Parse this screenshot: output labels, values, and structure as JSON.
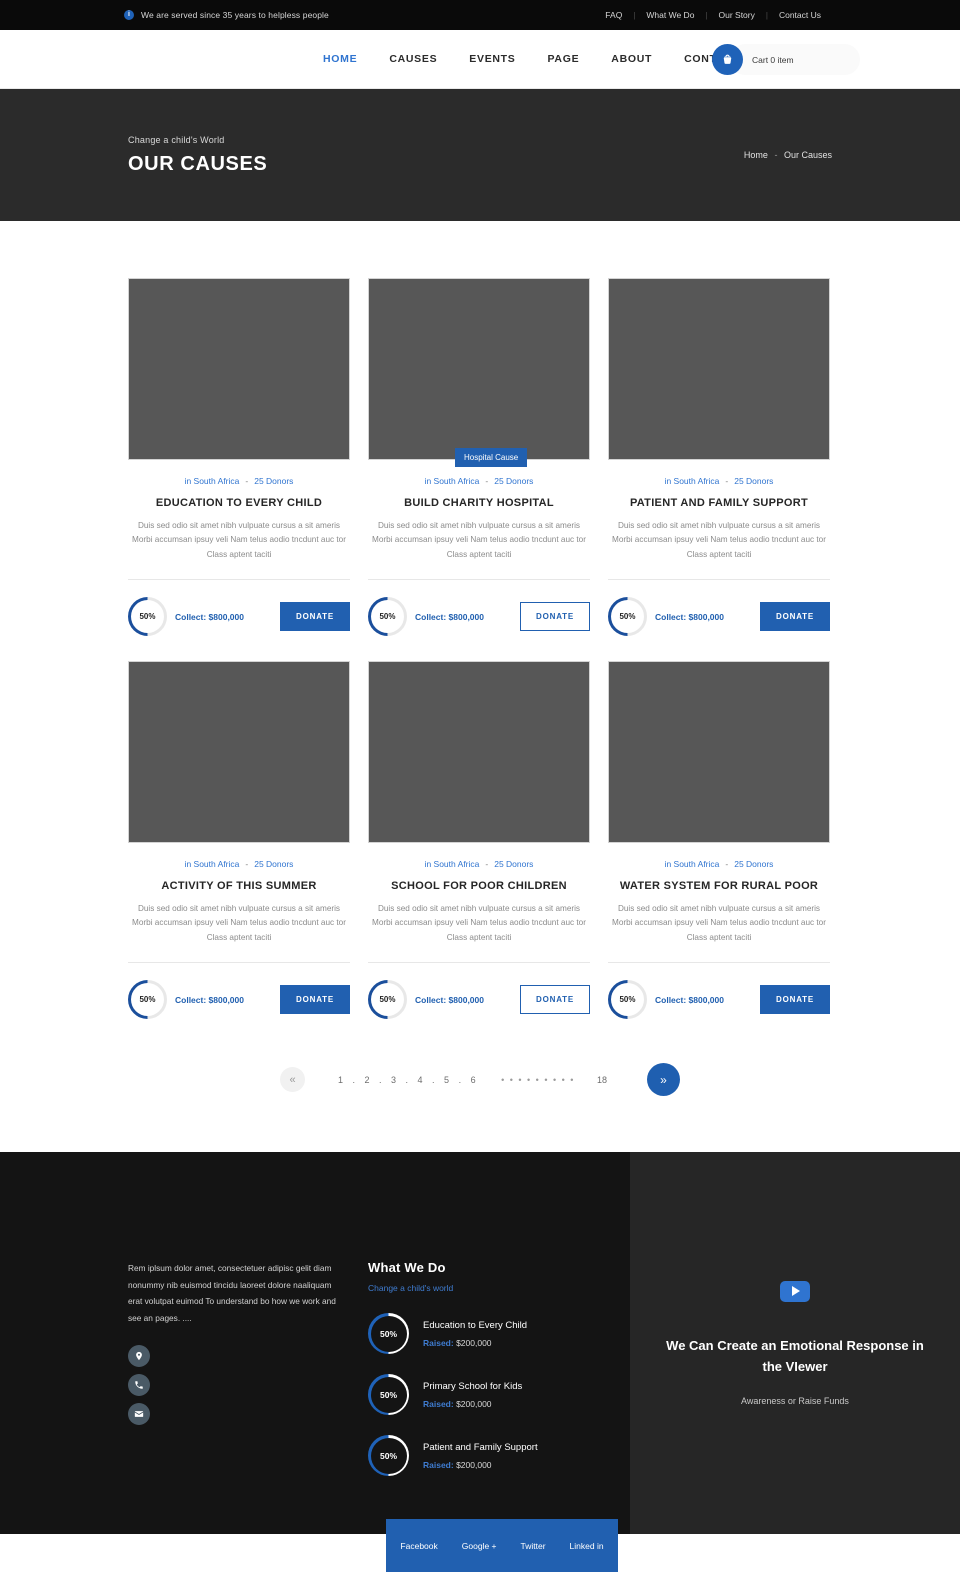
{
  "topbar": {
    "info_icon": "info-icon",
    "message": "We are served since 35 years to helpless people",
    "links": [
      {
        "label": "FAQ"
      },
      {
        "label": "What We Do"
      },
      {
        "label": "Our Story"
      },
      {
        "label": "Contact Us"
      }
    ],
    "separator": "|"
  },
  "nav": {
    "items": [
      {
        "label": "HOME",
        "active": true
      },
      {
        "label": "CAUSES",
        "active": false
      },
      {
        "label": "EVENTS",
        "active": false
      },
      {
        "label": "PAGE",
        "active": false
      },
      {
        "label": "ABOUT",
        "active": false
      },
      {
        "label": "CONTACT",
        "active": false
      }
    ],
    "cart_icon": "shopping-basket-icon",
    "cart_label": "Cart 0 item"
  },
  "hero": {
    "subtitle": "Change a child's World",
    "title": "OUR CAUSES",
    "breadcrumb_home": "Home",
    "breadcrumb_sep": "-",
    "breadcrumb_current": "Our Causes"
  },
  "causes": {
    "location_label": "in South Africa",
    "meta_sep": "-",
    "donors_label": "25 Donors",
    "description": "Duis sed odio sit amet nibh vulpuate cursus a sit ameris Morbi accumsan ipsuy veli Nam telus aodio tncdunt auc tor Class aptent taciti",
    "percent": "50%",
    "collect_label": "Collect:",
    "collect_amount": "$800,000",
    "donate_label": "DONATE",
    "cards": [
      {
        "title": "EDUCATION TO EVERY CHILD",
        "badge": null,
        "button_style": "filled"
      },
      {
        "title": "BUILD CHARITY HOSPITAL",
        "badge": "Hospital Cause",
        "button_style": "outline"
      },
      {
        "title": "PATIENT AND FAMILY SUPPORT",
        "badge": null,
        "button_style": "filled"
      },
      {
        "title": "ACTIVITY OF THIS SUMMER",
        "badge": null,
        "button_style": "filled"
      },
      {
        "title": "SCHOOL FOR POOR CHILDREN",
        "badge": null,
        "button_style": "outline"
      },
      {
        "title": "WATER SYSTEM FOR RURAL POOR",
        "badge": null,
        "button_style": "filled"
      }
    ]
  },
  "pagination": {
    "prev_icon": "chevron-double-left-icon",
    "numbers": "1 . 2 . 3 . 4 . 5 . 6",
    "dots": "• • • • • • • • •",
    "last_page": "18",
    "next_icon": "chevron-double-right-icon"
  },
  "footer": {
    "about_text": "Rem iplsum dolor amet, consectetuer adipisc gelit diam nonummy nib euismod tincidu laoreet dolore naaliquam erat volutpat euimod To understand bo how we work and see an pages. ....",
    "social_circle_icons": [
      "location-pin-icon",
      "phone-icon",
      "envelope-icon"
    ],
    "what_we_do": {
      "title": "What We Do",
      "subtitle": "Change a child's world",
      "raised_label": "Raised:",
      "items": [
        {
          "percent": "50%",
          "name": "Education to Every Child",
          "amount": "$200,000"
        },
        {
          "percent": "50%",
          "name": "Primary School for Kids",
          "amount": "$200,000"
        },
        {
          "percent": "50%",
          "name": "Patient and Family Support",
          "amount": "$200,000"
        }
      ]
    },
    "video": {
      "play_icon": "youtube-play-icon",
      "title": "We Can Create an Emotional Response in the VIewer",
      "subtitle": "Awareness or Raise Funds"
    },
    "social_links": [
      {
        "label": "Facebook"
      },
      {
        "label": "Google +"
      },
      {
        "label": "Twitter"
      },
      {
        "label": "Linked in"
      }
    ]
  },
  "colors": {
    "accent_blue": "#2160b0",
    "link_blue": "#2f74d0",
    "hero_bg": "#2b2b2b",
    "footer_bg": "#141414",
    "footer_panel_bg": "#262626",
    "image_placeholder": "#575757"
  }
}
